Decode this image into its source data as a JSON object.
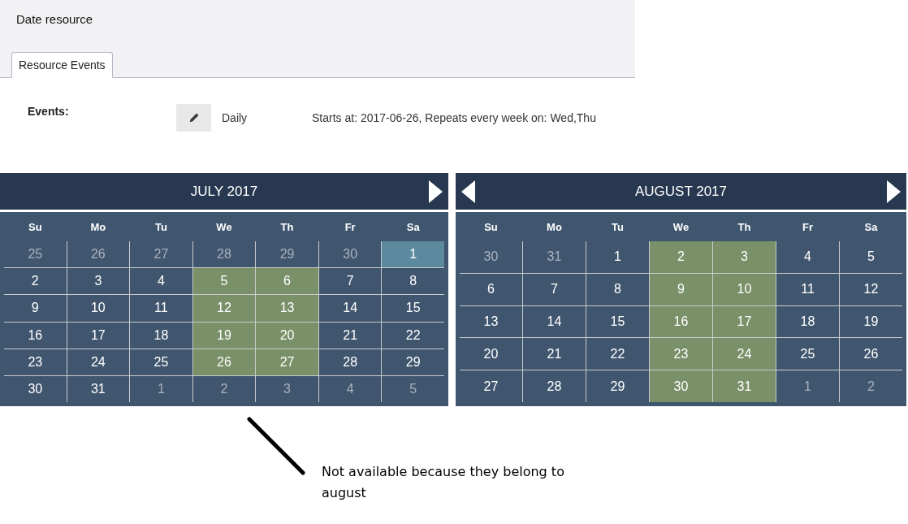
{
  "header": {
    "title": "Date resource"
  },
  "tabs": [
    {
      "label": "Resource Events",
      "selected": true
    }
  ],
  "events": {
    "label": "Events:",
    "items": [
      {
        "frequency": "Daily",
        "description": "Starts at: 2017-06-26, Repeats every week on: Wed,Thu"
      }
    ]
  },
  "calendars": [
    {
      "title": "JULY 2017",
      "prev_arrow": false,
      "next_arrow": true,
      "weekdays": [
        "Su",
        "Mo",
        "Tu",
        "We",
        "Th",
        "Fr",
        "Sa"
      ],
      "weeks": [
        [
          {
            "day": "25",
            "outside": true,
            "event": false,
            "selected": false
          },
          {
            "day": "26",
            "outside": true,
            "event": false,
            "selected": false
          },
          {
            "day": "27",
            "outside": true,
            "event": false,
            "selected": false
          },
          {
            "day": "28",
            "outside": true,
            "event": false,
            "selected": false
          },
          {
            "day": "29",
            "outside": true,
            "event": false,
            "selected": false
          },
          {
            "day": "30",
            "outside": true,
            "event": false,
            "selected": false
          },
          {
            "day": "1",
            "outside": false,
            "event": false,
            "selected": true
          }
        ],
        [
          {
            "day": "2",
            "outside": false,
            "event": false,
            "selected": false
          },
          {
            "day": "3",
            "outside": false,
            "event": false,
            "selected": false
          },
          {
            "day": "4",
            "outside": false,
            "event": false,
            "selected": false
          },
          {
            "day": "5",
            "outside": false,
            "event": true,
            "selected": false
          },
          {
            "day": "6",
            "outside": false,
            "event": true,
            "selected": false
          },
          {
            "day": "7",
            "outside": false,
            "event": false,
            "selected": false
          },
          {
            "day": "8",
            "outside": false,
            "event": false,
            "selected": false
          }
        ],
        [
          {
            "day": "9",
            "outside": false,
            "event": false,
            "selected": false
          },
          {
            "day": "10",
            "outside": false,
            "event": false,
            "selected": false
          },
          {
            "day": "11",
            "outside": false,
            "event": false,
            "selected": false
          },
          {
            "day": "12",
            "outside": false,
            "event": true,
            "selected": false
          },
          {
            "day": "13",
            "outside": false,
            "event": true,
            "selected": false
          },
          {
            "day": "14",
            "outside": false,
            "event": false,
            "selected": false
          },
          {
            "day": "15",
            "outside": false,
            "event": false,
            "selected": false
          }
        ],
        [
          {
            "day": "16",
            "outside": false,
            "event": false,
            "selected": false
          },
          {
            "day": "17",
            "outside": false,
            "event": false,
            "selected": false
          },
          {
            "day": "18",
            "outside": false,
            "event": false,
            "selected": false
          },
          {
            "day": "19",
            "outside": false,
            "event": true,
            "selected": false
          },
          {
            "day": "20",
            "outside": false,
            "event": true,
            "selected": false
          },
          {
            "day": "21",
            "outside": false,
            "event": false,
            "selected": false
          },
          {
            "day": "22",
            "outside": false,
            "event": false,
            "selected": false
          }
        ],
        [
          {
            "day": "23",
            "outside": false,
            "event": false,
            "selected": false
          },
          {
            "day": "24",
            "outside": false,
            "event": false,
            "selected": false
          },
          {
            "day": "25",
            "outside": false,
            "event": false,
            "selected": false
          },
          {
            "day": "26",
            "outside": false,
            "event": true,
            "selected": false
          },
          {
            "day": "27",
            "outside": false,
            "event": true,
            "selected": false
          },
          {
            "day": "28",
            "outside": false,
            "event": false,
            "selected": false
          },
          {
            "day": "29",
            "outside": false,
            "event": false,
            "selected": false
          }
        ],
        [
          {
            "day": "30",
            "outside": false,
            "event": false,
            "selected": false
          },
          {
            "day": "31",
            "outside": false,
            "event": false,
            "selected": false
          },
          {
            "day": "1",
            "outside": true,
            "event": false,
            "selected": false
          },
          {
            "day": "2",
            "outside": true,
            "event": false,
            "selected": false
          },
          {
            "day": "3",
            "outside": true,
            "event": false,
            "selected": false
          },
          {
            "day": "4",
            "outside": true,
            "event": false,
            "selected": false
          },
          {
            "day": "5",
            "outside": true,
            "event": false,
            "selected": false
          }
        ]
      ]
    },
    {
      "title": "AUGUST 2017",
      "prev_arrow": true,
      "next_arrow": true,
      "weekdays": [
        "Su",
        "Mo",
        "Tu",
        "We",
        "Th",
        "Fr",
        "Sa"
      ],
      "weeks": [
        [
          {
            "day": "30",
            "outside": true,
            "event": false,
            "selected": false
          },
          {
            "day": "31",
            "outside": true,
            "event": false,
            "selected": false
          },
          {
            "day": "1",
            "outside": false,
            "event": false,
            "selected": false
          },
          {
            "day": "2",
            "outside": false,
            "event": true,
            "selected": false
          },
          {
            "day": "3",
            "outside": false,
            "event": true,
            "selected": false
          },
          {
            "day": "4",
            "outside": false,
            "event": false,
            "selected": false
          },
          {
            "day": "5",
            "outside": false,
            "event": false,
            "selected": false
          }
        ],
        [
          {
            "day": "6",
            "outside": false,
            "event": false,
            "selected": false
          },
          {
            "day": "7",
            "outside": false,
            "event": false,
            "selected": false
          },
          {
            "day": "8",
            "outside": false,
            "event": false,
            "selected": false
          },
          {
            "day": "9",
            "outside": false,
            "event": true,
            "selected": false
          },
          {
            "day": "10",
            "outside": false,
            "event": true,
            "selected": false
          },
          {
            "day": "11",
            "outside": false,
            "event": false,
            "selected": false
          },
          {
            "day": "12",
            "outside": false,
            "event": false,
            "selected": false
          }
        ],
        [
          {
            "day": "13",
            "outside": false,
            "event": false,
            "selected": false
          },
          {
            "day": "14",
            "outside": false,
            "event": false,
            "selected": false
          },
          {
            "day": "15",
            "outside": false,
            "event": false,
            "selected": false
          },
          {
            "day": "16",
            "outside": false,
            "event": true,
            "selected": false
          },
          {
            "day": "17",
            "outside": false,
            "event": true,
            "selected": false
          },
          {
            "day": "18",
            "outside": false,
            "event": false,
            "selected": false
          },
          {
            "day": "19",
            "outside": false,
            "event": false,
            "selected": false
          }
        ],
        [
          {
            "day": "20",
            "outside": false,
            "event": false,
            "selected": false
          },
          {
            "day": "21",
            "outside": false,
            "event": false,
            "selected": false
          },
          {
            "day": "22",
            "outside": false,
            "event": false,
            "selected": false
          },
          {
            "day": "23",
            "outside": false,
            "event": true,
            "selected": false
          },
          {
            "day": "24",
            "outside": false,
            "event": true,
            "selected": false
          },
          {
            "day": "25",
            "outside": false,
            "event": false,
            "selected": false
          },
          {
            "day": "26",
            "outside": false,
            "event": false,
            "selected": false
          }
        ],
        [
          {
            "day": "27",
            "outside": false,
            "event": false,
            "selected": false
          },
          {
            "day": "28",
            "outside": false,
            "event": false,
            "selected": false
          },
          {
            "day": "29",
            "outside": false,
            "event": false,
            "selected": false
          },
          {
            "day": "30",
            "outside": false,
            "event": true,
            "selected": false
          },
          {
            "day": "31",
            "outside": false,
            "event": true,
            "selected": false
          },
          {
            "day": "1",
            "outside": true,
            "event": false,
            "selected": false
          },
          {
            "day": "2",
            "outside": true,
            "event": false,
            "selected": false
          }
        ]
      ]
    }
  ],
  "annotation": {
    "text": "Not available because they belong to august"
  }
}
